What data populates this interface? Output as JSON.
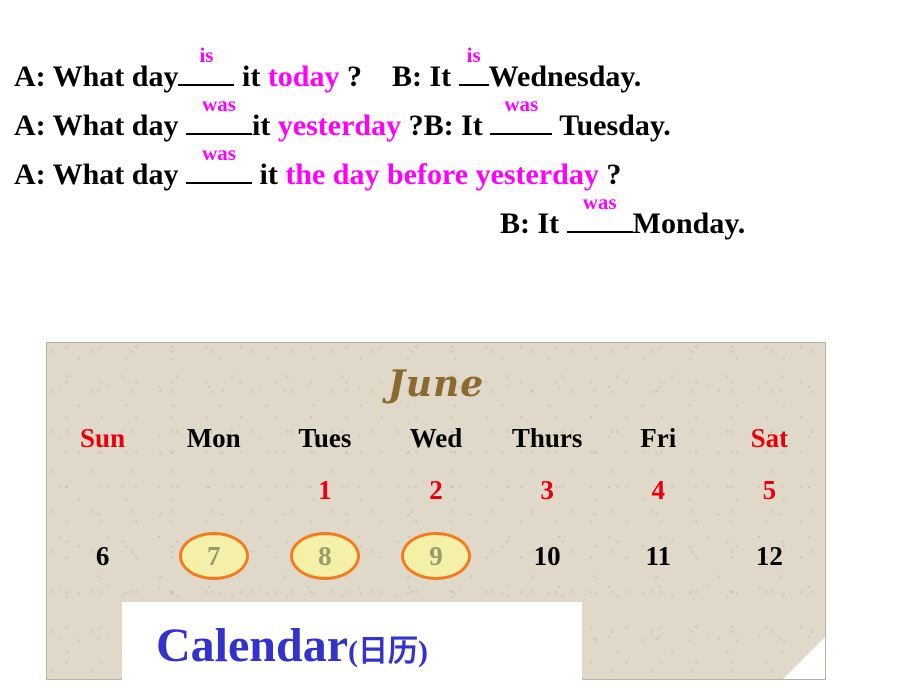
{
  "dialogue": {
    "lines": [
      {
        "id": "line1",
        "seg_a_label": "A: What day",
        "answer1": "is",
        "mid1": "it",
        "keyword": "today",
        "tail1": "?",
        "seg_b_label": "B: It",
        "answer2": "is",
        "tail2": "Wednesday."
      },
      {
        "id": "line2",
        "seg_a_label": "A: What day",
        "answer1": "was",
        "mid1": "it",
        "keyword": "yesterday",
        "tail1": "?",
        "seg_b_label": "B: It",
        "answer2": "was",
        "tail2": "Tuesday."
      },
      {
        "id": "line3",
        "seg_a_label": "A: What day",
        "answer1": "was",
        "mid1": "it",
        "keyword": "the day before yesterday",
        "tail1": "?"
      },
      {
        "id": "line4",
        "seg_b_label": "B: It",
        "answer2": "was",
        "tail2": "Monday."
      }
    ],
    "accent_color": "#ff00ff"
  },
  "calendar": {
    "month": "June",
    "weekday_headers": [
      {
        "label": "Sun",
        "color": "red"
      },
      {
        "label": "Mon",
        "color": "black"
      },
      {
        "label": "Tues",
        "color": "black"
      },
      {
        "label": "Wed",
        "color": "black"
      },
      {
        "label": "Thurs",
        "color": "black"
      },
      {
        "label": "Fri",
        "color": "black"
      },
      {
        "label": "Sat",
        "color": "red"
      }
    ],
    "week1": [
      {
        "value": "",
        "color": "black",
        "circled": false
      },
      {
        "value": "",
        "color": "black",
        "circled": false
      },
      {
        "value": "1",
        "color": "red",
        "circled": false
      },
      {
        "value": "2",
        "color": "red",
        "circled": false
      },
      {
        "value": "3",
        "color": "red",
        "circled": false
      },
      {
        "value": "4",
        "color": "red",
        "circled": false
      },
      {
        "value": "5",
        "color": "red",
        "circled": false
      }
    ],
    "week2": [
      {
        "value": "6",
        "color": "black",
        "circled": false
      },
      {
        "value": "7",
        "color": "olive",
        "circled": true
      },
      {
        "value": "8",
        "color": "olive",
        "circled": true
      },
      {
        "value": "9",
        "color": "olive",
        "circled": true
      },
      {
        "value": "10",
        "color": "black",
        "circled": false
      },
      {
        "value": "11",
        "color": "black",
        "circled": false
      },
      {
        "value": "12",
        "color": "black",
        "circled": false
      }
    ],
    "highlight_circle_color": "#f47a20",
    "highlight_fill_color": "#f5f0a8",
    "header_red": "#e8000d",
    "month_color": "#8a6a2f",
    "paper_color": "#e0d8c8"
  },
  "title_box": {
    "title_en": "Calendar",
    "title_cn": "(日历)",
    "color": "#3333cc"
  }
}
